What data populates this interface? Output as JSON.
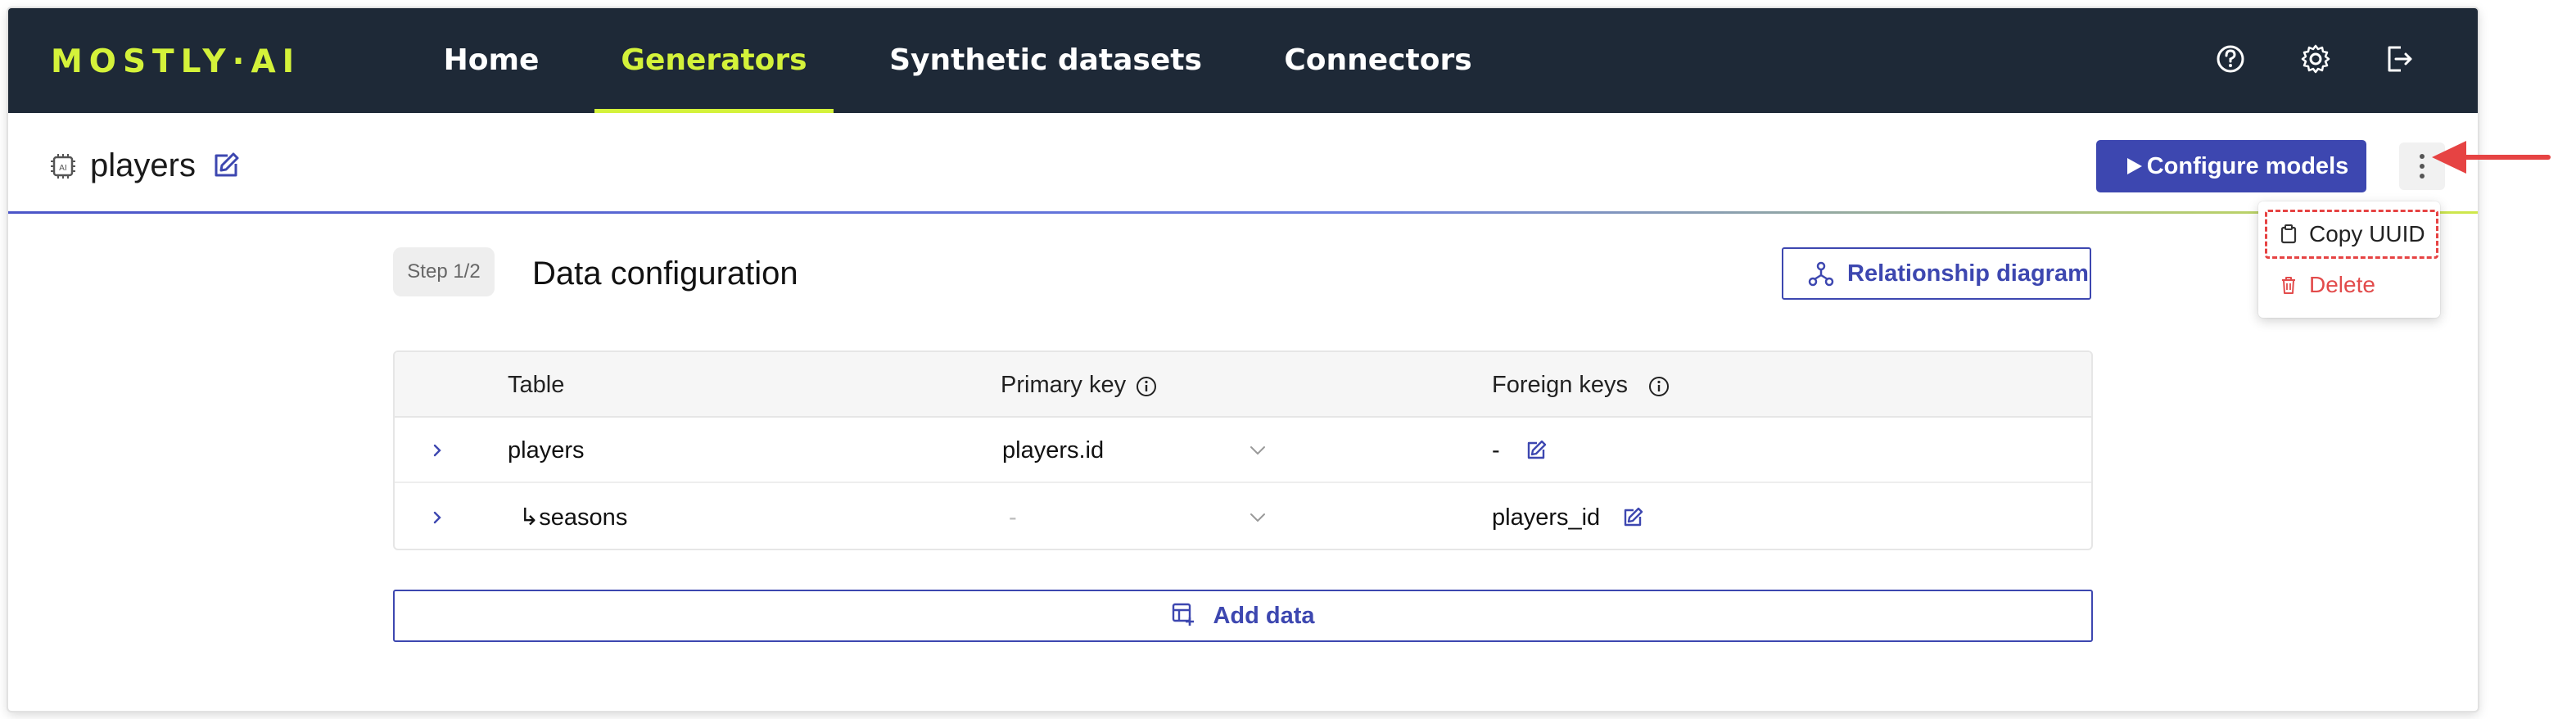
{
  "nav": {
    "logo": "MOSTLY·AI",
    "items": [
      "Home",
      "Generators",
      "Synthetic datasets",
      "Connectors"
    ],
    "active": "Generators",
    "icons": [
      "help-icon",
      "settings-icon",
      "logout-icon"
    ]
  },
  "header": {
    "title": "players",
    "configure_label": "Configure models"
  },
  "menu": {
    "copy_label": "Copy UUID",
    "delete_label": "Delete"
  },
  "content": {
    "step": "Step 1/2",
    "title": "Data configuration",
    "relationship_label": "Relationship diagram",
    "add_data_label": "Add data"
  },
  "table": {
    "headers": [
      "Table",
      "Primary key",
      "Foreign keys"
    ],
    "rows": [
      {
        "table": "players",
        "primary_key": "players.id",
        "foreign_keys": "-"
      },
      {
        "table": "↳seasons",
        "primary_key": "-",
        "foreign_keys": "players_id"
      }
    ]
  },
  "colors": {
    "nav_bg": "#1e2937",
    "accent_lime": "#d4f23a",
    "primary": "#3d47b0",
    "danger": "#e24b4b"
  }
}
